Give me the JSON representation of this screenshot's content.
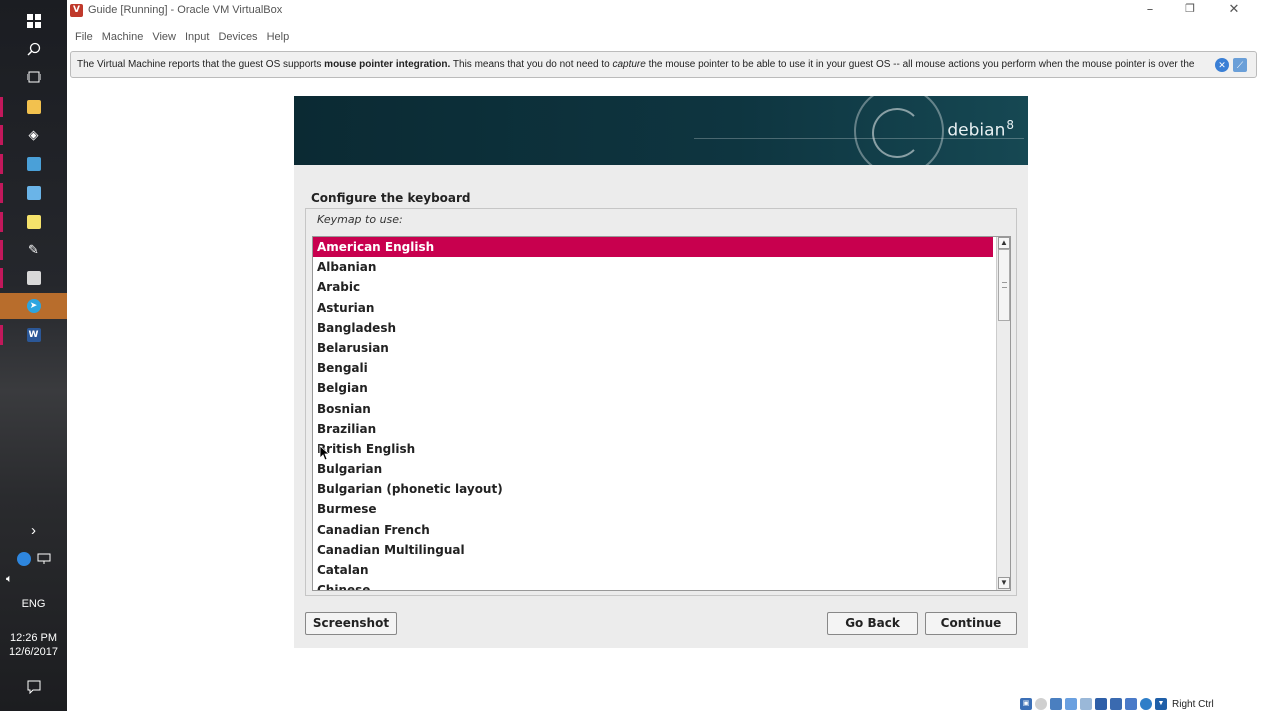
{
  "window": {
    "title": "Guide [Running] - Oracle VM VirtualBox",
    "menu": [
      "File",
      "Machine",
      "View",
      "Input",
      "Devices",
      "Help"
    ],
    "minimize": "–",
    "restore": "❐",
    "close": "✕"
  },
  "notice": {
    "prefix": "The Virtual Machine reports that the guest OS supports ",
    "bold": "mouse pointer integration.",
    "middle": " This means that you do not need to ",
    "italic": "capture",
    "suffix": " the mouse pointer to be able to use it in your guest OS -- all mouse actions you perform when the mouse pointer is over the"
  },
  "taskbar": {
    "chevron": "›",
    "language": "ENG",
    "time": "12:26 PM",
    "date": "12/6/2017"
  },
  "installer": {
    "logo": "debian",
    "logo_version": "8",
    "title": "Configure the keyboard",
    "keymap_label": "Keymap to use:",
    "keymaps": [
      "American English",
      "Albanian",
      "Arabic",
      "Asturian",
      "Bangladesh",
      "Belarusian",
      "Bengali",
      "Belgian",
      "Bosnian",
      "Brazilian",
      "British English",
      "Bulgarian",
      "Bulgarian (phonetic layout)",
      "Burmese",
      "Canadian French",
      "Canadian Multilingual",
      "Catalan",
      "Chinese"
    ],
    "selected": "American English",
    "buttons": {
      "screenshot": "Screenshot",
      "go_back": "Go Back",
      "continue": "Continue"
    }
  },
  "statusbar": {
    "host_key": "Right Ctrl"
  },
  "colors": {
    "selection": "#c8004e",
    "banner": "#0e3540",
    "taskbar_active": "#b86d2c"
  }
}
